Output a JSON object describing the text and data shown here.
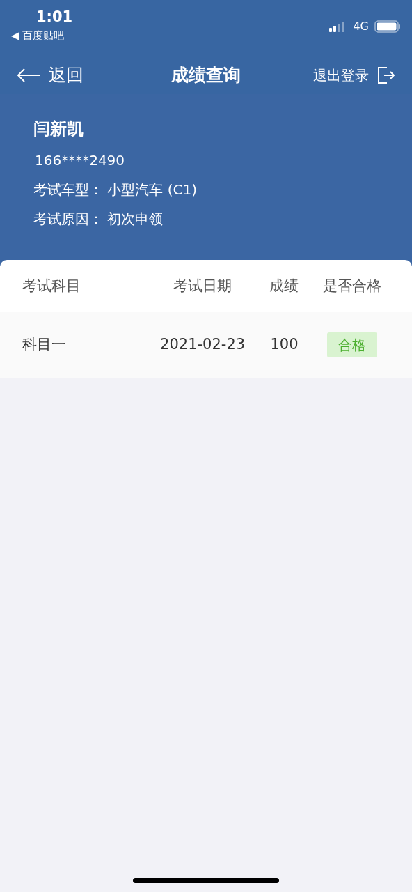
{
  "status_bar": {
    "time": "1:01",
    "back_app": "◀ 百度贴吧",
    "network": "4G"
  },
  "nav": {
    "back": "返回",
    "title": "成绩查询",
    "logout": "退出登录"
  },
  "profile": {
    "name": "闫新凯",
    "phone": "166****2490",
    "lines": [
      {
        "label": "考试车型：",
        "value": "小型汽车 (C1)"
      },
      {
        "label": "考试原因：",
        "value": "初次申领"
      }
    ]
  },
  "table": {
    "columns": [
      "考试科目",
      "考试日期",
      "成绩",
      "是否合格"
    ],
    "rows": [
      {
        "subject": "科目一",
        "date": "2021-02-23",
        "score": "100",
        "result": {
          "text": "合格",
          "passed": true
        }
      }
    ]
  }
}
